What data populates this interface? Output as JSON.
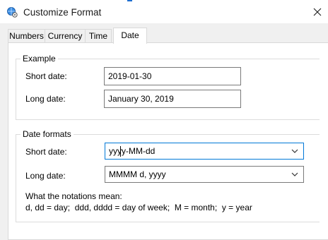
{
  "window": {
    "title": "Customize Format",
    "close_icon": "close-icon",
    "app_icon": "globe-settings-icon"
  },
  "tabs": [
    {
      "label": "Numbers",
      "selected": false
    },
    {
      "label": "Currency",
      "selected": false
    },
    {
      "label": "Time",
      "selected": false
    },
    {
      "label": "Date",
      "selected": true
    }
  ],
  "example": {
    "legend": "Example",
    "short_label": "Short date:",
    "short_value": "2019-01-30",
    "long_label": "Long date:",
    "long_value": "January 30, 2019"
  },
  "formats": {
    "legend": "Date formats",
    "short_label": "Short date:",
    "short_value": "yyyy-MM-dd",
    "long_label": "Long date:",
    "long_value": "MMMM d, yyyy",
    "notation_heading": "What the notations mean:",
    "notation_text": "d, dd = day;  ddd, dddd = day of week;  M = month;  y = year"
  },
  "colors": {
    "focus_border": "#0078d7",
    "window_bg": "#f0f0f0"
  }
}
